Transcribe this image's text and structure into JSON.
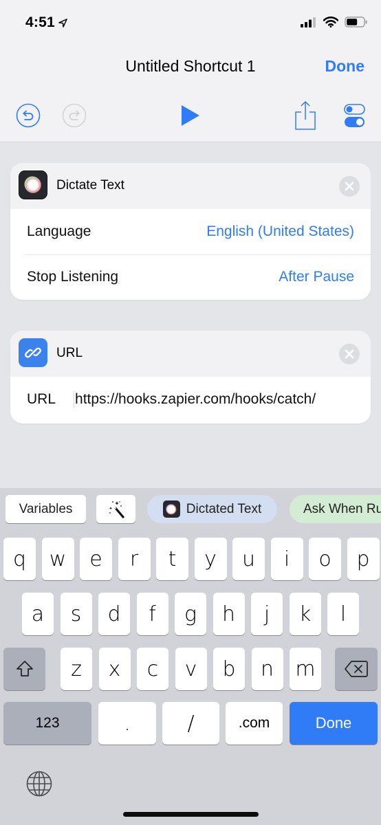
{
  "status_bar": {
    "time": "4:51",
    "location_icon": "location-arrow-icon",
    "signal_icon": "cellular-signal-icon",
    "wifi_icon": "wifi-icon",
    "battery_icon": "battery-icon"
  },
  "nav": {
    "title": "Untitled Shortcut 1",
    "done_label": "Done"
  },
  "toolbar": {
    "undo_icon": "undo-icon",
    "redo_icon": "redo-icon",
    "play_icon": "play-icon",
    "share_icon": "share-icon",
    "settings_icon": "toggle-settings-icon"
  },
  "actions": [
    {
      "title": "Dictate Text",
      "icon": "dictate-icon",
      "rows": [
        {
          "label": "Language",
          "value": "English (United States)"
        },
        {
          "label": "Stop Listening",
          "value": "After Pause"
        }
      ]
    },
    {
      "title": "URL",
      "icon": "link-icon",
      "rows": [
        {
          "label": "URL",
          "value": "https://hooks.zapier.com/hooks/catch/"
        }
      ]
    }
  ],
  "suggestions": {
    "variables_label": "Variables",
    "magic_icon": "magic-wand-icon",
    "dictated_text_label": "Dictated Text",
    "ask_when_run_label": "Ask When Run"
  },
  "keyboard": {
    "row1": [
      "q",
      "w",
      "e",
      "r",
      "t",
      "y",
      "u",
      "i",
      "o",
      "p"
    ],
    "row2": [
      "a",
      "s",
      "d",
      "f",
      "g",
      "h",
      "j",
      "k",
      "l"
    ],
    "row3": [
      "z",
      "x",
      "c",
      "v",
      "b",
      "n",
      "m"
    ],
    "numbers_label": "123",
    "dot_label": ".",
    "slash_label": "/",
    "dotcom_label": ".com",
    "done_label": "Done"
  },
  "colors": {
    "accent": "#2f7cf6",
    "header_bg": "#f2f2f4",
    "canvas_bg": "#e4e5e9",
    "keyboard_bg": "#d1d3d9",
    "dictated_chip_bg": "#d3def0",
    "ask_chip_bg": "#d4ecd3"
  }
}
